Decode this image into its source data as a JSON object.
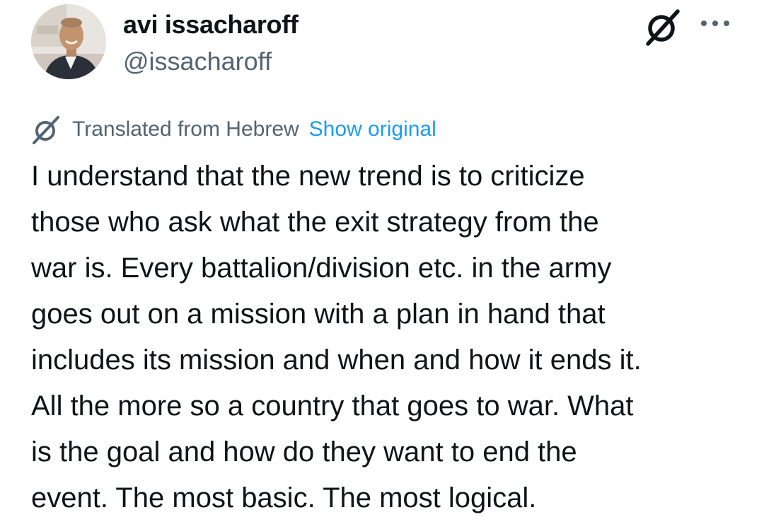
{
  "author": {
    "display_name": "avi issacharoff",
    "handle": "@issacharoff"
  },
  "icons": {
    "grok": "grok-icon",
    "more": "more-options-icon",
    "translate": "translate-icon"
  },
  "translation": {
    "label": "Translated from Hebrew",
    "show_original": "Show original"
  },
  "tweet": {
    "lines": [
      "I understand that the new trend is to criticize",
      "those who ask what the exit strategy from the",
      "war is. Every battalion/division etc. in the army",
      "goes out on a mission with a plan in hand that",
      "includes its mission and when and how it ends it.",
      "All the more so a country that goes to war. What",
      "is the goal and how do they want to end the",
      "event. The most basic. The most logical."
    ]
  },
  "colors": {
    "text": "#0f1419",
    "secondary": "#536471",
    "link": "#1d9bf0"
  }
}
